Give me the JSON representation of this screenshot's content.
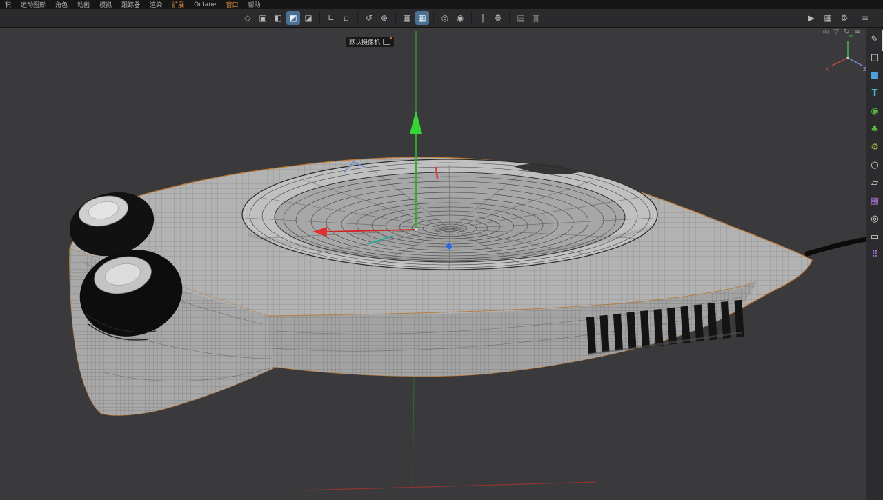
{
  "menu_bar": {
    "items": [
      {
        "label": "积"
      },
      {
        "label": "运动图形"
      },
      {
        "label": "角色"
      },
      {
        "label": "动画"
      },
      {
        "label": "模拟"
      },
      {
        "label": "跟踪器"
      },
      {
        "label": "渲染"
      },
      {
        "label": "扩展",
        "accent": true
      },
      {
        "label": "Octane"
      },
      {
        "label": "窗口",
        "accent": true
      },
      {
        "label": "帮助"
      }
    ]
  },
  "toolbar": {
    "groups": [
      {
        "icons": [
          {
            "name": "make-editable-icon",
            "glyph": "◇",
            "selected": false
          },
          {
            "name": "model-mode-icon",
            "glyph": "▣",
            "selected": false
          },
          {
            "name": "texture-mode-icon",
            "glyph": "◧",
            "selected": false
          },
          {
            "name": "polygon-mode-icon",
            "glyph": "◩",
            "selected": true
          },
          {
            "name": "uv-mode-icon",
            "glyph": "◪",
            "selected": false
          }
        ]
      },
      {
        "icons": [
          {
            "name": "workplane-icon",
            "glyph": "∟",
            "selected": false
          },
          {
            "name": "workplane-lock-icon",
            "glyph": "▫",
            "selected": false
          }
        ]
      },
      {
        "icons": [
          {
            "name": "coordinate-system-icon",
            "glyph": "↺",
            "selected": false
          },
          {
            "name": "axis-modify-icon",
            "glyph": "⊕",
            "selected": false
          }
        ]
      },
      {
        "icons": [
          {
            "name": "grid-snap-icon",
            "glyph": "▦",
            "selected": false
          },
          {
            "name": "quantize-icon",
            "glyph": "▦",
            "selected": true
          }
        ]
      },
      {
        "icons": [
          {
            "name": "snap-icon",
            "glyph": "◎",
            "selected": false
          },
          {
            "name": "magnet-snap-icon",
            "glyph": "◉",
            "selected": false
          }
        ]
      },
      {
        "icons": [
          {
            "name": "tweak-mode-icon",
            "glyph": "∥",
            "selected": false
          },
          {
            "name": "modeling-settings-icon",
            "glyph": "⚙",
            "selected": false
          }
        ]
      },
      {
        "icons": [
          {
            "name": "bake-icon",
            "glyph": "▤",
            "selected": false
          },
          {
            "name": "cache-icon",
            "glyph": "▥",
            "selected": false
          }
        ]
      }
    ],
    "right_icons": [
      {
        "name": "render-view-icon",
        "glyph": "▶"
      },
      {
        "name": "picture-viewer-icon",
        "glyph": "▦"
      },
      {
        "name": "render-settings-icon",
        "glyph": "⚙"
      }
    ],
    "layout_icon": {
      "name": "layout-icon",
      "glyph": "≡"
    }
  },
  "viewport": {
    "camera_label": "默认摄像机",
    "header_icons": [
      {
        "name": "display-mode-icon",
        "glyph": "◎"
      },
      {
        "name": "filter-icon",
        "glyph": "▽"
      },
      {
        "name": "refresh-icon",
        "glyph": "↻"
      },
      {
        "name": "viewport-menu-icon",
        "glyph": "≡"
      }
    ],
    "axis_gizmo": {
      "x_label": "X",
      "y_label": "Y",
      "z_label": "Z"
    }
  },
  "right_sidebar": {
    "icons": [
      {
        "name": "pen-tool-icon",
        "glyph": "✎",
        "color": "#d6d6d6"
      },
      {
        "name": "cube-primitive-icon",
        "glyph": "□",
        "color": "#d6d6d6"
      },
      {
        "name": "volume-cube-icon",
        "glyph": "■",
        "color": "#4f9fd8"
      },
      {
        "name": "motext-icon",
        "glyph": "T",
        "color": "#45b8c8"
      },
      {
        "name": "subdivision-surface-icon",
        "glyph": "◉",
        "color": "#58b544"
      },
      {
        "name": "generator-icon",
        "glyph": "♣",
        "color": "#58b544"
      },
      {
        "name": "deformer-gear-icon",
        "glyph": "⚙",
        "color": "#a5b43c"
      },
      {
        "name": "spline-circle-icon",
        "glyph": "○",
        "color": "#d6d6d6"
      },
      {
        "name": "plane-icon",
        "glyph": "▱",
        "color": "#d6d6d6"
      },
      {
        "name": "cloner-icon",
        "glyph": "▦",
        "color": "#a96fd4"
      },
      {
        "name": "sky-icon",
        "glyph": "◎",
        "color": "#d6d6d6"
      },
      {
        "name": "floor-icon",
        "glyph": "▭",
        "color": "#d6d6d6"
      },
      {
        "name": "matrix-icon",
        "glyph": "⠿",
        "color": "#a96fd4"
      }
    ]
  },
  "colors": {
    "accent_orange": "#cf8a3f",
    "selection_blue": "#4a7194",
    "outline_orange": "#c07a36",
    "axis_green": "#35d435",
    "axis_red": "#e03030",
    "axis_blue": "#3566cc",
    "viewport_bg": "#3a3a3c"
  }
}
